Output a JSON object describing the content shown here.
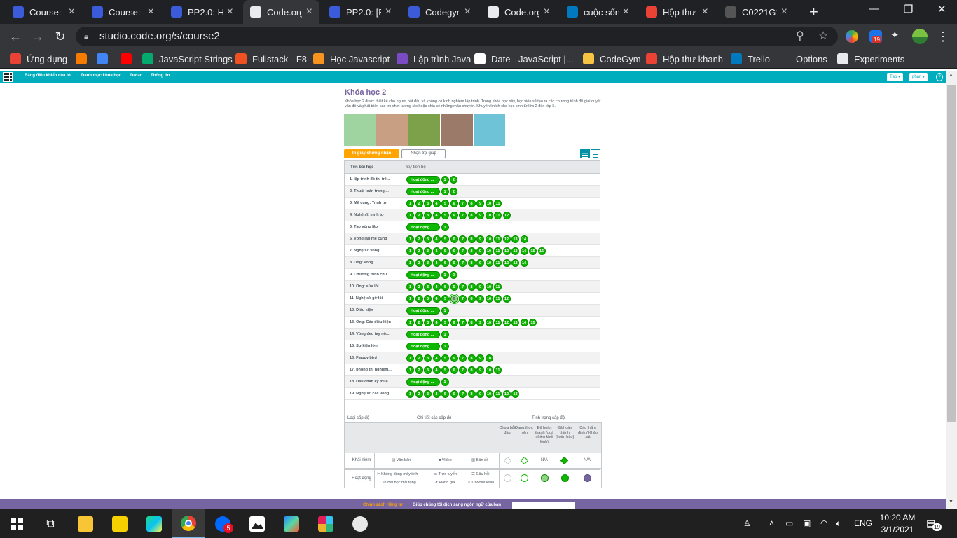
{
  "browser": {
    "tabs": [
      {
        "title": "Course: B",
        "icon": "codegym-icon",
        "color": "#3b5bdb"
      },
      {
        "title": "Course: B",
        "icon": "codegym-icon",
        "color": "#3b5bdb"
      },
      {
        "title": "PP2.0: Họ",
        "icon": "codegym-icon",
        "color": "#3b5bdb"
      },
      {
        "title": "Code.org",
        "icon": "codeorg-icon",
        "color": "#e8eaed",
        "active": true
      },
      {
        "title": "PP2.0: [Bà",
        "icon": "codegym-icon",
        "color": "#3b5bdb"
      },
      {
        "title": "Codegym",
        "icon": "codegym-icon",
        "color": "#3b5bdb"
      },
      {
        "title": "Code.org",
        "icon": "codeorg-icon",
        "color": "#e8eaed"
      },
      {
        "title": "cuộc sống",
        "icon": "trello-icon",
        "color": "#0079bf"
      },
      {
        "title": "Hộp thư đ",
        "icon": "gmail-icon",
        "color": "#ea4335"
      },
      {
        "title": "C0221G1",
        "icon": "github-icon",
        "color": "#555555"
      }
    ],
    "url": "studio.code.org/s/course2",
    "extension_badge": "19",
    "bookmarks": [
      {
        "label": "Ứng dụng",
        "icon": "apps-grid-icon",
        "color": "#ea4335"
      },
      {
        "label": "",
        "icon": "fire-icon",
        "color": "#f57c00"
      },
      {
        "label": "",
        "icon": "google-translate-icon",
        "color": "#4285f4"
      },
      {
        "label": "",
        "icon": "youtube-icon",
        "color": "#ff0000"
      },
      {
        "label": "JavaScript Strings",
        "icon": "w3schools-icon",
        "color": "#04aa6d"
      },
      {
        "label": "Fullstack - F8",
        "icon": "f8-icon",
        "color": "#f05123"
      },
      {
        "label": "Học Javascript",
        "icon": "j-icon",
        "color": "#f7931e"
      },
      {
        "label": "Lập trình Java",
        "icon": "k-icon",
        "color": "#7b4bc4"
      },
      {
        "label": "Date - JavaScript |...",
        "icon": "mdn-icon",
        "color": "#ffffff"
      },
      {
        "label": "CodeGym",
        "icon": "folder-icon",
        "color": "#f6c343"
      },
      {
        "label": "Hộp thư khanh",
        "icon": "gmail-icon",
        "color": "#ea4335"
      },
      {
        "label": "Trello",
        "icon": "trello-icon",
        "color": "#0079bf"
      },
      {
        "label": "Options",
        "icon": "blank-icon",
        "color": "#35363a"
      },
      {
        "label": "Experiments",
        "icon": "flask-icon",
        "color": "#e8eaed"
      }
    ]
  },
  "codeorg_header": {
    "nav": [
      "Bảng điều khiển của tôi",
      "Danh mục khóa học",
      "Dự án",
      "Thông tin"
    ],
    "create_label": "Tạo ▾",
    "user_label": "phan ▾",
    "help_label": "?"
  },
  "course": {
    "title": "Khóa học 2",
    "description": "Khóa học 2 được thiết kế cho người bắt đầu và không có kinh nghiệm lập trình. Trong khóa học này, học viên sẽ tạo ra các chương trình để giải quyết vấn đề và phát triển các trò chơi tương tác hoặc chia sẻ những mẩu chuyện. Khuyến khích cho học sinh từ lớp 2 đến lớp 5.",
    "thumbnails": [
      {
        "name": "character-thumbnail",
        "color": "#9fd3a0"
      },
      {
        "name": "kids-thumbnail",
        "color": "#c89f82"
      },
      {
        "name": "artist-thumbnail",
        "color": "#7da14a"
      },
      {
        "name": "gates-thumbnail",
        "color": "#9c7a6a"
      },
      {
        "name": "flappy-thumbnail",
        "color": "#6ec4d6"
      }
    ],
    "certificate_label": "In giấy chứng nhận",
    "help_label": "Nhận trợ giúp"
  },
  "progress_table": {
    "col_lesson": "Tên bài học",
    "col_progress": "Sự tiến bộ",
    "rows": [
      {
        "label": "1. lập trình đồ thị trê...",
        "pill": "Hoạt động ...",
        "bubbles": [
          "1",
          "2"
        ]
      },
      {
        "label": "2. Thuật toán trong ...",
        "pill": "Hoạt động ...",
        "bubbles": [
          "1",
          "2"
        ]
      },
      {
        "label": "3. Mê cung: Trình tự",
        "pill": "",
        "bubbles": [
          "1",
          "2",
          "3",
          "4",
          "5",
          "6",
          "7",
          "8",
          "9",
          "10",
          "11"
        ]
      },
      {
        "label": "4. Nghệ sĩ: trình tự",
        "pill": "",
        "bubbles": [
          "1",
          "2",
          "3",
          "4",
          "5",
          "6",
          "7",
          "8",
          "9",
          "10",
          "11",
          "12"
        ]
      },
      {
        "label": "5. Tạo vòng lặp",
        "pill": "Hoạt động ...",
        "bubbles": [
          "1"
        ]
      },
      {
        "label": "6. Vòng lặp mê cung",
        "pill": "",
        "bubbles": [
          "1",
          "2",
          "3",
          "4",
          "5",
          "6",
          "7",
          "8",
          "9",
          "10",
          "11",
          "12",
          "13",
          "14"
        ]
      },
      {
        "label": "7. Nghệ sĩ: vòng",
        "pill": "",
        "bubbles": [
          "1",
          "2",
          "3",
          "4",
          "5",
          "6",
          "7",
          "8",
          "9",
          "10",
          "11",
          "12",
          "13",
          "14",
          "15",
          "16"
        ]
      },
      {
        "label": "8. Ong: vòng",
        "pill": "",
        "bubbles": [
          "1",
          "2",
          "3",
          "4",
          "5",
          "6",
          "7",
          "8",
          "9",
          "10",
          "11",
          "12",
          "13",
          "14"
        ]
      },
      {
        "label": "9. Chương trình chu...",
        "pill": "Hoạt động ...",
        "bubbles": [
          "1",
          "2"
        ]
      },
      {
        "label": "10. Ong: sửa lỗi",
        "pill": "",
        "bubbles": [
          "1",
          "2",
          "3",
          "4",
          "5",
          "6",
          "7",
          "8",
          "9",
          "10",
          "11"
        ]
      },
      {
        "label": "11. Nghệ sĩ: gỡ lỗi",
        "pill": "",
        "bubbles": [
          "1",
          "2",
          "3",
          "4",
          "5",
          "6",
          "7",
          "8",
          "9",
          "10",
          "11",
          "12"
        ],
        "current": 5
      },
      {
        "label": "12. Điều kiện",
        "pill": "Hoạt động ...",
        "bubbles": [
          "1"
        ]
      },
      {
        "label": "13. Ong: Các điều kiện",
        "pill": "",
        "bubbles": [
          "1",
          "2",
          "3",
          "4",
          "5",
          "6",
          "7",
          "8",
          "9",
          "10",
          "11",
          "12",
          "13",
          "14",
          "15"
        ]
      },
      {
        "label": "14. Vòng đeo tay nộ...",
        "pill": "Hoạt động ...",
        "bubbles": [
          "1"
        ]
      },
      {
        "label": "15. Sự kiện lớn",
        "pill": "Hoạt động ...",
        "bubbles": [
          "1"
        ]
      },
      {
        "label": "16. Flappy bird",
        "pill": "",
        "bubbles": [
          "1",
          "2",
          "3",
          "4",
          "5",
          "6",
          "7",
          "8",
          "9",
          "10"
        ]
      },
      {
        "label": "17. phòng thí nghiệm...",
        "pill": "",
        "bubbles": [
          "1",
          "2",
          "3",
          "4",
          "5",
          "6",
          "7",
          "8",
          "9",
          "10",
          "11"
        ]
      },
      {
        "label": "18. Dấu chân kỹ thuậ...",
        "pill": "Hoạt động ...",
        "bubbles": [
          "1"
        ]
      },
      {
        "label": "19. Nghệ sĩ: các vòng...",
        "pill": "",
        "bubbles": [
          "1",
          "2",
          "3",
          "4",
          "5",
          "6",
          "7",
          "8",
          "9",
          "10",
          "11",
          "12",
          "13"
        ]
      }
    ]
  },
  "legend": {
    "header_type": "Loại cấp độ",
    "header_details": "Chi tiết các cấp độ",
    "header_status": "Tình trạng cấp độ",
    "status_cols": [
      "Chưa bắt đầu",
      "Đang thực hiện",
      "Đã hoàn thành (quá nhiều khối lệnh)",
      "Đã hoàn thành (hoàn hảo)",
      "Các thẩm định / Khảo sát"
    ],
    "row_concept": "Khái niệm",
    "row_activity": "Hoạt động",
    "concept_types": [
      "Văn bản",
      "Video",
      "Bản đồ"
    ],
    "activity_types": [
      "Không dùng máy tính",
      "Trực tuyến",
      "Câu hỏi",
      "Bài học mở rộng",
      "Đánh giá",
      "Choose level"
    ],
    "na": "N/A"
  },
  "footer": {
    "policy": "Chính sách riêng tư",
    "translate": "Giúp chúng tôi dịch sang ngôn ngữ của bạn"
  },
  "taskbar": {
    "zalo_badge": "5",
    "language": "ENG",
    "time": "10:20 AM",
    "date": "3/1/2021",
    "notification_count": "19"
  }
}
